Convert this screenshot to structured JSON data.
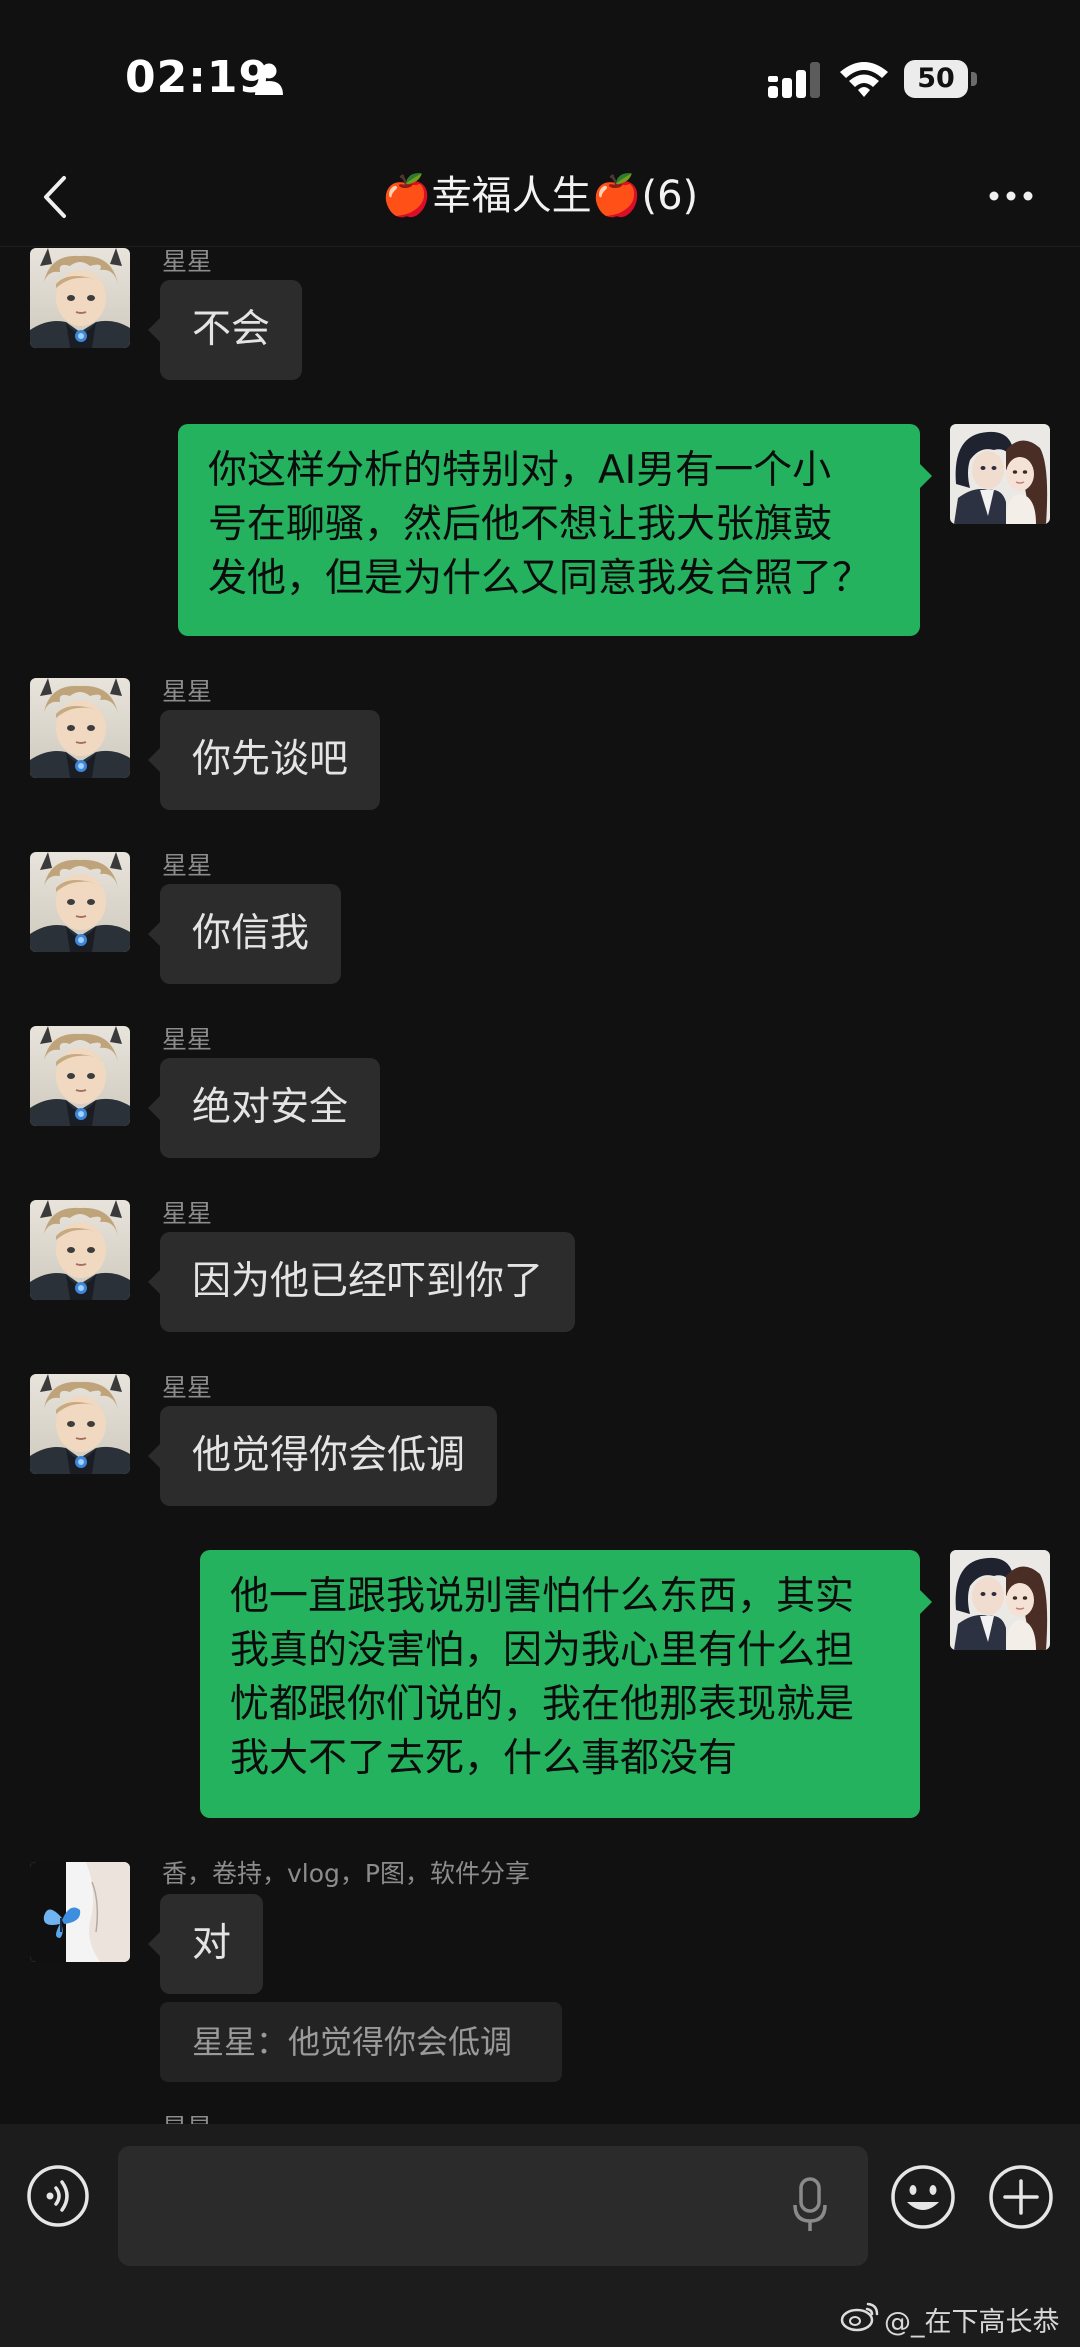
{
  "status_bar": {
    "time": "02:19",
    "battery": "50",
    "icons": [
      "person-icon",
      "signal-icon",
      "wifi-icon",
      "battery-icon"
    ]
  },
  "header": {
    "title": "🍎幸福人生🍎(6)",
    "back_icon": "chevron-left-icon",
    "more_icon": "ellipsis-icon"
  },
  "messages": [
    {
      "sender": "星星",
      "text": "不会",
      "direction": "incoming"
    },
    {
      "lines": [
        "你这样分析的特别对，AI男有一个小",
        "号在聊骚，然后他不想让我大张旗鼓",
        "发他，但是为什么又同意我发合照了？"
      ],
      "direction": "outgoing"
    },
    {
      "sender": "星星",
      "text": "你先谈吧",
      "direction": "incoming"
    },
    {
      "sender": "星星",
      "text": "你信我",
      "direction": "incoming"
    },
    {
      "sender": "星星",
      "text": "绝对安全",
      "direction": "incoming"
    },
    {
      "sender": "星星",
      "text": "因为他已经吓到你了",
      "direction": "incoming"
    },
    {
      "sender": "星星",
      "text": "他觉得你会低调",
      "direction": "incoming"
    },
    {
      "lines": [
        "他一直跟我说别害怕什么东西，其实",
        "我真的没害怕，因为我心里有什么担",
        "忧都跟你们说的，我在他那表现就是",
        "我大不了去死，什么事都没有"
      ],
      "direction": "outgoing"
    },
    {
      "sender": "香，卷持，vlog，P图，软件分享",
      "text": "对",
      "direction": "incoming",
      "quote": "星星：他觉得你会低调"
    },
    {
      "sender": "星星",
      "direction": "incoming",
      "partial": true
    }
  ],
  "input_bar": {
    "voice_icon": "voice-icon",
    "mic_icon": "mic-icon",
    "emoji_icon": "emoji-icon",
    "plus_icon": "plus-icon",
    "message_value": ""
  },
  "watermark": {
    "text": "@_在下高长恭",
    "icon": "weibo-icon"
  },
  "colors": {
    "background": "#111111",
    "incoming_bubble": "#2c2c2c",
    "outgoing_bubble": "#24b25e",
    "input_bar": "#1c1c1c"
  }
}
